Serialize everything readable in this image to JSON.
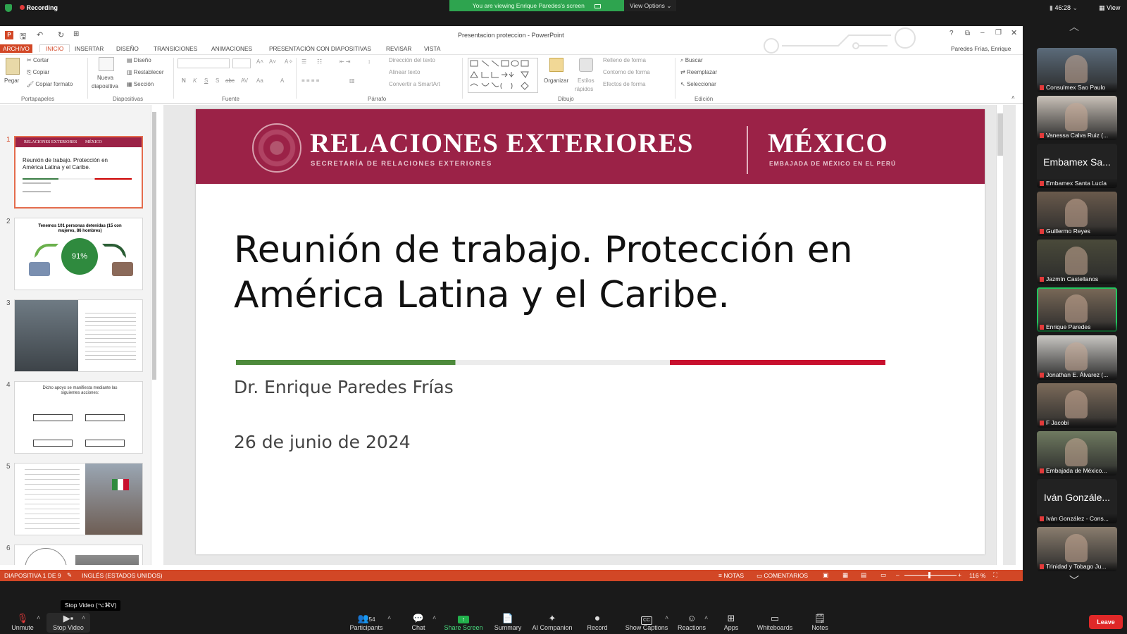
{
  "zoom": {
    "recording_label": "Recording",
    "banner": "You are viewing Enrique Paredes's screen",
    "view_options": "View Options",
    "timer": "46:28",
    "view_label": "View",
    "tooltip": "Stop Video (⌥⌘V)",
    "toolbar": {
      "unmute": "Unmute",
      "stop_video": "Stop Video",
      "participants": "Participants",
      "participants_count": "54",
      "chat": "Chat",
      "share_screen": "Share Screen",
      "summary": "Summary",
      "ai_companion": "AI Companion",
      "record": "Record",
      "show_captions": "Show Captions",
      "reactions": "Reactions",
      "apps": "Apps",
      "whiteboards": "Whiteboards",
      "notes": "Notes",
      "leave": "Leave"
    },
    "participants": [
      {
        "name": "Consulmex Sao Paulo",
        "kind": "video"
      },
      {
        "name": "Vanessa Calva Ruiz (...",
        "kind": "video"
      },
      {
        "name": "Embamex Santa Lucía",
        "kind": "name",
        "big": "Embamex Sa..."
      },
      {
        "name": "Guillermo Reyes",
        "kind": "video"
      },
      {
        "name": "Jazmín Castellanos",
        "kind": "video"
      },
      {
        "name": "Enrique Paredes",
        "kind": "video",
        "active": true
      },
      {
        "name": "Jonathan E. Álvarez (...",
        "kind": "video"
      },
      {
        "name": "F Jacobi",
        "kind": "video"
      },
      {
        "name": "Embajada de México...",
        "kind": "video"
      },
      {
        "name": "Iván González - Cons...",
        "kind": "name",
        "big": "Iván Gonzále..."
      },
      {
        "name": "Trinidad y Tobago Ju...",
        "kind": "video"
      }
    ]
  },
  "ppt": {
    "window_title": "Presentacion proteccion - PowerPoint",
    "user": "Paredes Frías, Enrique",
    "tabs": [
      "ARCHIVO",
      "INICIO",
      "INSERTAR",
      "DISEÑO",
      "TRANSICIONES",
      "ANIMACIONES",
      "PRESENTACIÓN CON DIAPOSITIVAS",
      "REVISAR",
      "VISTA"
    ],
    "ribbon": {
      "pegar": "Pegar",
      "cortar": "Cortar",
      "copiar": "Copiar",
      "copiar_formato": "Copiar formato",
      "portapapeles": "Portapapeles",
      "nueva_diapositiva": "Nueva",
      "nueva_diapositiva2": "diapositiva",
      "diseno": "Diseño",
      "restablecer": "Restablecer",
      "seccion": "Sección",
      "diapositivas": "Diapositivas",
      "fuente": "Fuente",
      "direccion_texto": "Dirección del texto",
      "alinear_texto": "Alinear texto",
      "convertir_smartart": "Convertir a SmartArt",
      "parrafo": "Párrafo",
      "organizar": "Organizar",
      "estilos": "Estilos",
      "estilos2": "rápidos",
      "relleno": "Relleno de forma",
      "contorno": "Contorno de forma",
      "efectos": "Efectos de forma",
      "dibujo": "Dibujo",
      "buscar": "Buscar",
      "reemplazar": "Reemplazar",
      "seleccionar": "Seleccionar",
      "edicion": "Edición"
    },
    "thumbs": {
      "t1_header_left": "RELACIONES EXTERIORES",
      "t1_header_right": "MÉXICO",
      "t1_title": "Reunión de trabajo. Protección en América Latina y el Caribe.",
      "t2_title": "Tenemos 101 personas detenidas (15 con mujeres, 86 hombres)",
      "t2_percent": "91%",
      "t4_title": "Dicho apoyo se manifiesta mediante las siguientes acciones:"
    },
    "slide": {
      "header_main": "RELACIONES EXTERIORES",
      "header_sub": "SECRETARÍA DE RELACIONES EXTERIORES",
      "header_country": "MÉXICO",
      "header_country_sub": "EMBAJADA DE MÉXICO EN EL PERÚ",
      "title_line1": "Reunión de trabajo. Protección en",
      "title_line2": "América Latina y el Caribe.",
      "author": "Dr. Enrique Paredes Frías",
      "date": "26 de junio de 2024"
    },
    "status": {
      "slide_info": "DIAPOSITIVA 1 DE 9",
      "language": "INGLÉS (ESTADOS UNIDOS)",
      "notes": "NOTAS",
      "comments": "COMENTARIOS",
      "zoom": "116 %"
    }
  }
}
